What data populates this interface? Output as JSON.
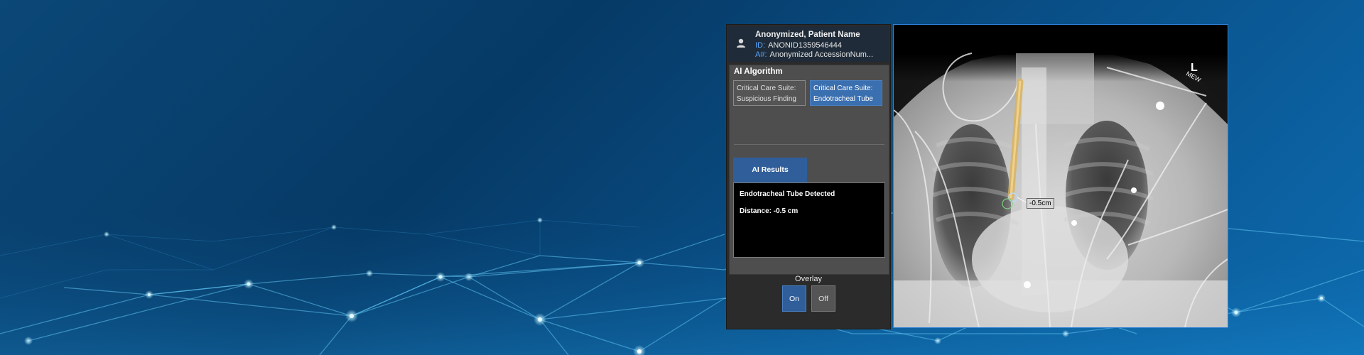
{
  "patient": {
    "name": "Anonymized, Patient Name",
    "id_label": "ID:",
    "id_value": "ANONID1359546444",
    "accession_label": "A#:",
    "accession_value": "Anonymized AccessionNum..."
  },
  "algorithm": {
    "title": "AI Algorithm",
    "options": [
      {
        "line1": "Critical Care Suite:",
        "line2": "Suspicious Finding",
        "selected": false
      },
      {
        "line1": "Critical Care Suite:",
        "line2": "Endotracheal Tube",
        "selected": true
      }
    ]
  },
  "results": {
    "tab_label": "AI Results",
    "lines": [
      "Endotracheal Tube Detected",
      "Distance: -0.5 cm"
    ]
  },
  "overlay": {
    "label": "Overlay",
    "on_label": "On",
    "off_label": "Off",
    "selected": "On"
  },
  "viewer": {
    "measurement_label": "-0.5cm",
    "orientation_letter": "L",
    "orientation_sub": "MEW"
  },
  "colors": {
    "accent_blue": "#2f5e9a",
    "viewer_border": "#2f7fd6",
    "id_label_blue": "#5aa9ff"
  }
}
